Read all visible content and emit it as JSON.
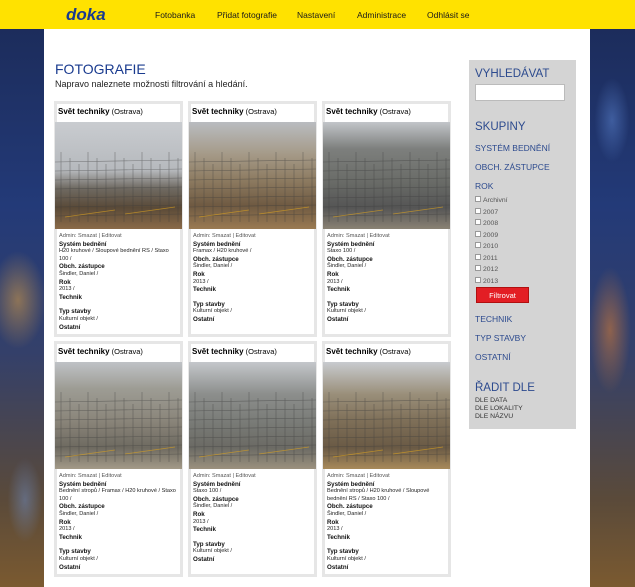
{
  "nav": {
    "logo": "doka",
    "items": [
      "Fotobanka",
      "Přidat fotografie",
      "Nastavení",
      "Administrace",
      "Odhlásit se"
    ]
  },
  "page": {
    "title": "FOTOGRAFIE",
    "subtitle": "Napravo naleznete možnosti filtrování a hledání."
  },
  "cards": [
    {
      "title": "Svět techniky",
      "place": "(Ostrava)",
      "admin": "Admin: Smazat | Editovat",
      "system_label": "Systém bednění",
      "system": "H20 kruhové / Sloupové bednění RS / Staxo 100 /",
      "rep_label": "Obch. zástupce",
      "rep": "Šindler, Daniel /",
      "year_label": "Rok",
      "year": "2013 /",
      "tech_label": "Technik",
      "type_label": "Typ stavby",
      "type": "Kulturní objekt /",
      "other_label": "Ostatní"
    },
    {
      "title": "Svět techniky",
      "place": "(Ostrava)",
      "admin": "Admin: Smazat | Editovat",
      "system_label": "Systém bednění",
      "system": "Framax / H20 kruhové /",
      "rep_label": "Obch. zástupce",
      "rep": "Šindler, Daniel /",
      "year_label": "Rok",
      "year": "2013 /",
      "tech_label": "Technik",
      "type_label": "Typ stavby",
      "type": "Kulturní objekt /",
      "other_label": "Ostatní"
    },
    {
      "title": "Svět techniky",
      "place": "(Ostrava)",
      "admin": "Admin: Smazat | Editovat",
      "system_label": "Systém bednění",
      "system": "Staxo 100 /",
      "rep_label": "Obch. zástupce",
      "rep": "Šindler, Daniel /",
      "year_label": "Rok",
      "year": "2013 /",
      "tech_label": "Technik",
      "type_label": "Typ stavby",
      "type": "Kulturní objekt /",
      "other_label": "Ostatní"
    },
    {
      "title": "Svět techniky",
      "place": "(Ostrava)",
      "admin": "Admin: Smazat | Editovat",
      "system_label": "Systém bednění",
      "system": "Bednění stropů / Framax / H20 kruhové / Staxo 100 /",
      "rep_label": "Obch. zástupce",
      "rep": "Šindler, Daniel /",
      "year_label": "Rok",
      "year": "2013 /",
      "tech_label": "Technik",
      "type_label": "Typ stavby",
      "type": "Kulturní objekt /",
      "other_label": "Ostatní"
    },
    {
      "title": "Svět techniky",
      "place": "(Ostrava)",
      "admin": "Admin: Smazat | Editovat",
      "system_label": "Systém bednění",
      "system": "Staxo 100 /",
      "rep_label": "Obch. zástupce",
      "rep": "Šindler, Daniel /",
      "year_label": "Rok",
      "year": "2013 /",
      "tech_label": "Technik",
      "type_label": "Typ stavby",
      "type": "Kulturní objekt /",
      "other_label": "Ostatní"
    },
    {
      "title": "Svět techniky",
      "place": "(Ostrava)",
      "admin": "Admin: Smazat | Editovat",
      "system_label": "Systém bednění",
      "system": "Bednění stropů / H20 kruhové / Sloupové bednění RS / Staxo 100 /",
      "rep_label": "Obch. zástupce",
      "rep": "Šindler, Daniel /",
      "year_label": "Rok",
      "year": "2013 /",
      "tech_label": "Technik",
      "type_label": "Typ stavby",
      "type": "Kulturní objekt /",
      "other_label": "Ostatní"
    }
  ],
  "sidebar": {
    "search_head": "VYHLEDÁVAT",
    "groups_head": "SKUPINY",
    "group_system": "SYSTÉM BEDNĚNÍ",
    "group_rep": "OBCH. ZÁSTUPCE",
    "group_year": "ROK",
    "years": [
      "Archivní",
      "2007",
      "2008",
      "2009",
      "2010",
      "2011",
      "2012",
      "2013"
    ],
    "filter_btn": "Filtrovat",
    "group_tech": "TECHNIK",
    "group_type": "TYP STAVBY",
    "group_other": "OSTATNÍ",
    "sort_head": "ŘADIT DLE",
    "sort_date": "DLE DATA",
    "sort_loc": "DLE LOKALITY",
    "sort_name": "DLE NÁZVU"
  },
  "colors": {
    "topbar": "#ffe200",
    "brand": "#1a3b8f",
    "sidebar_link": "#2c4a8e",
    "filter_button": "#e31e24"
  }
}
